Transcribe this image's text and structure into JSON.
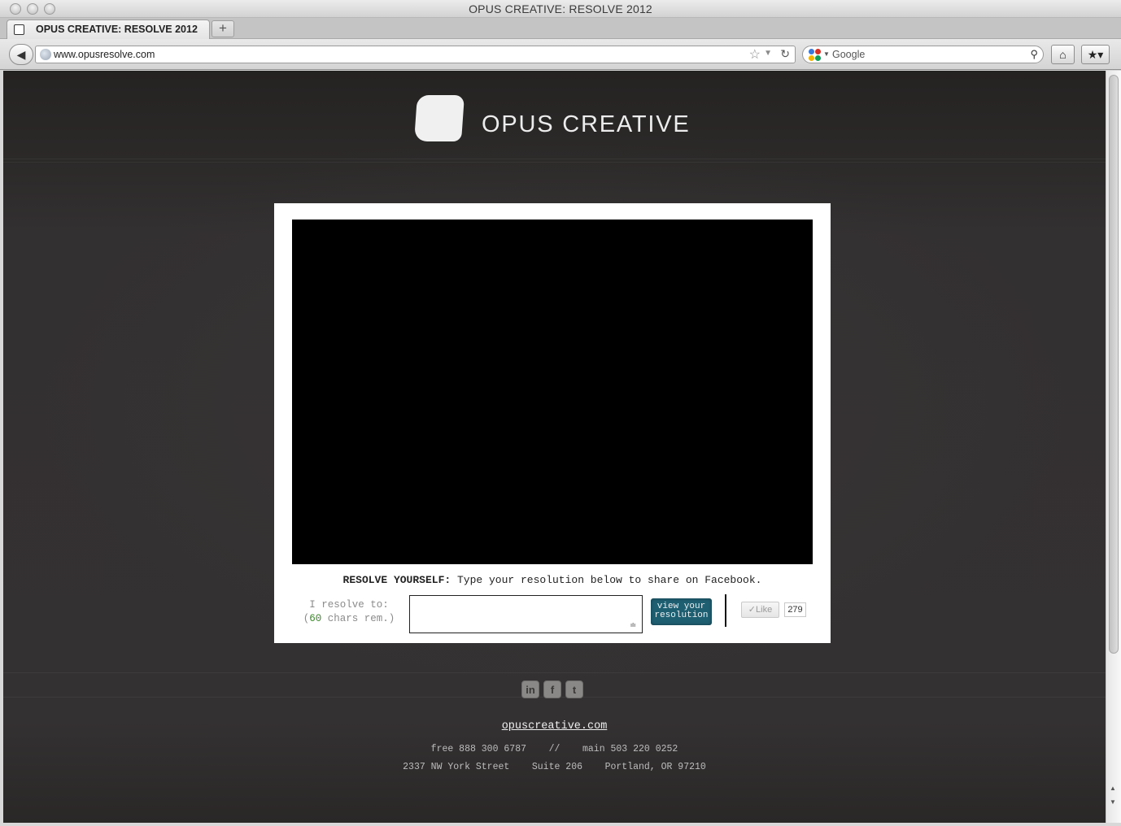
{
  "window": {
    "title": "OPUS CREATIVE: RESOLVE 2012"
  },
  "tabs": [
    {
      "label": "OPUS CREATIVE: RESOLVE 2012"
    }
  ],
  "navbar": {
    "url": "www.opusresolve.com",
    "search_placeholder": "Google"
  },
  "icons": {
    "back": "arrow-left",
    "reload": "reload",
    "bookmark_star": "star",
    "search": "magnifier",
    "home": "home",
    "bookmarks": "bookmark-star"
  },
  "page": {
    "brand": "OPUS CREATIVE",
    "prompt": {
      "bold": "RESOLVE YOURSELF:",
      "text": " Type your resolution below to share on Facebook."
    },
    "resolve_label": "I resolve to:",
    "chars_prefix": "(",
    "chars_remaining": "60",
    "chars_suffix": " chars rem.)",
    "resolution_value": "",
    "view_button_label": "view your resolution",
    "like": {
      "label": "Like",
      "count": "279"
    },
    "social": [
      {
        "name": "linkedin",
        "glyph": "in"
      },
      {
        "name": "facebook",
        "glyph": "f"
      },
      {
        "name": "twitter",
        "glyph": "t"
      }
    ],
    "footer": {
      "link": "opuscreative.com",
      "phone_line": "free 888 300 6787    //    main 503 220 0252",
      "address_line": "2337 NW York Street    Suite 206    Portland, OR 97210"
    }
  },
  "colors": {
    "page_bg": "#2f2c2d",
    "button_teal": "#1f5f72",
    "chars_green": "#3b8a2a"
  }
}
